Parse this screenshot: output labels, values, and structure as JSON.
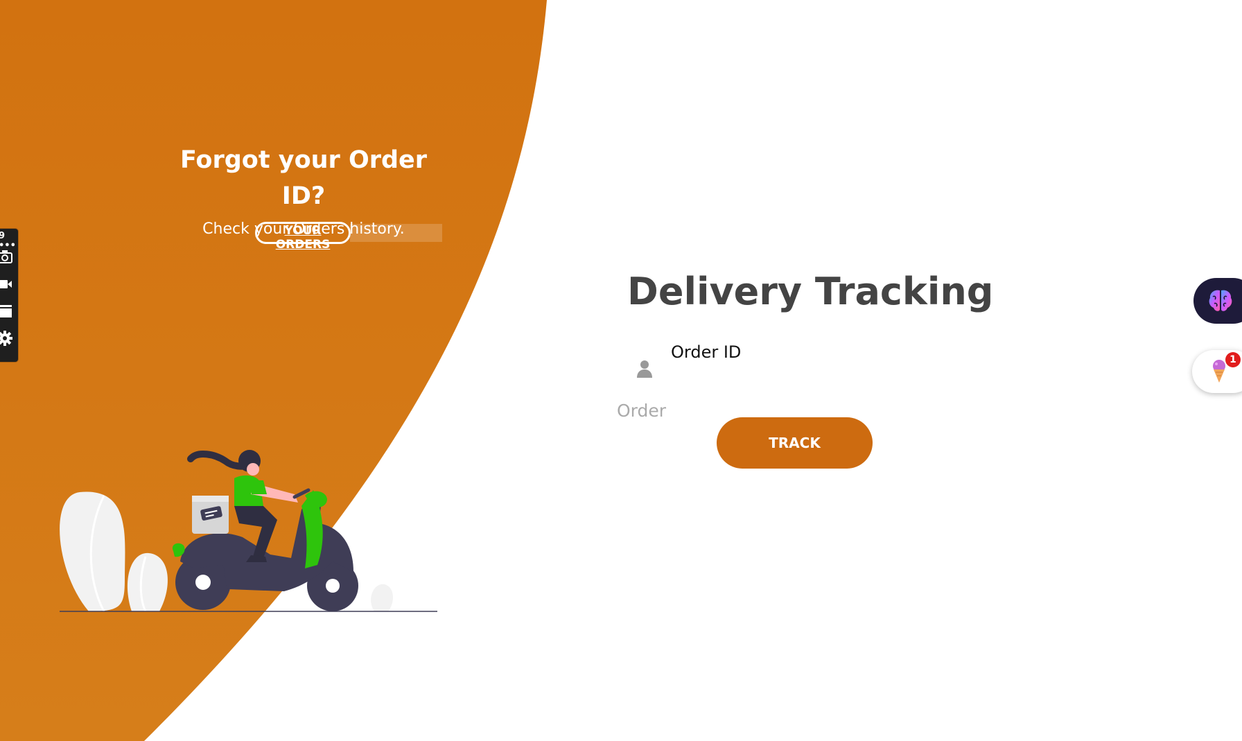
{
  "left_panel": {
    "title": "Forgot your Order ID?",
    "subtitle": "Check your Orders history.",
    "orders_button_label": "YOUR ORDERS"
  },
  "tracking": {
    "title": "Delivery Tracking",
    "field_label": "Order ID",
    "input_placeholder": "Order",
    "input_value": "",
    "track_button_label": "TRACK"
  },
  "screenshot_toolbar": {
    "header_glyph": "9 •••",
    "icons": [
      "camera-icon",
      "video-icon",
      "window-icon",
      "gear-icon"
    ]
  },
  "extensions": {
    "brain": {
      "icon": "brain-icon"
    },
    "cone": {
      "icon": "ice-cream-icon",
      "badge_count": "1"
    }
  },
  "colors": {
    "brand_orange": "#d2730f",
    "button_orange": "#cd6b10",
    "title_gray": "#444444",
    "placeholder_gray": "#aaaaaa",
    "illustration_dark": "#3f3d56",
    "illustration_green": "#2ec40c"
  }
}
